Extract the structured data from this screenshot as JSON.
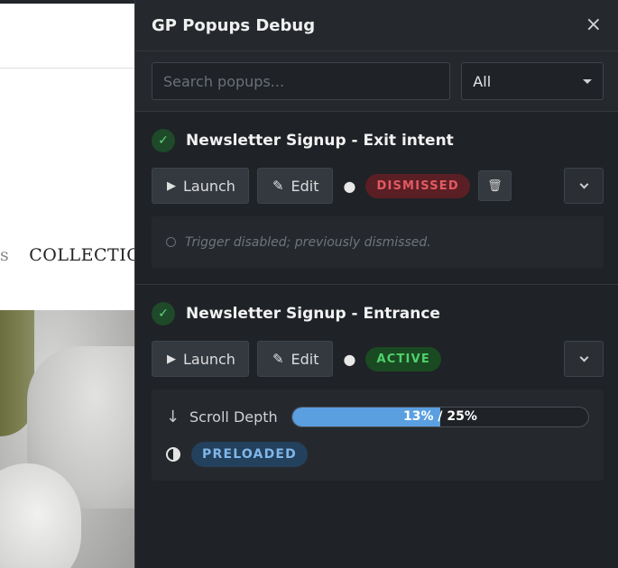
{
  "background_site": {
    "nav_partial": "COLLECTIO",
    "nav_separator": "s"
  },
  "panel": {
    "title": "GP Popups Debug",
    "close_icon": "×",
    "search": {
      "placeholder": "Search popups...",
      "value": ""
    },
    "filter": {
      "selected": "All"
    },
    "popups": [
      {
        "name": "Newsletter Signup - Exit intent",
        "enabled": true,
        "launch_label": "Launch",
        "edit_label": "Edit",
        "status": "DISMISSED",
        "status_color": "#e25a63",
        "trigger_text": "Trigger disabled; previously dismissed."
      },
      {
        "name": "Newsletter Signup - Entrance",
        "enabled": true,
        "launch_label": "Launch",
        "edit_label": "Edit",
        "status": "ACTIVE",
        "status_color": "#4fd16a",
        "trigger": {
          "label": "Scroll Depth",
          "progress_text": "13% / 25%",
          "current_percent": 13,
          "target_percent": 25,
          "progress_fraction": 0.5
        },
        "preload_badge": "PRELOADED"
      }
    ]
  },
  "colors": {
    "panel_bg": "#1f2226",
    "accent_blue": "#5a9fe0",
    "success_green": "#4fd16a",
    "danger_red": "#e25a63"
  }
}
